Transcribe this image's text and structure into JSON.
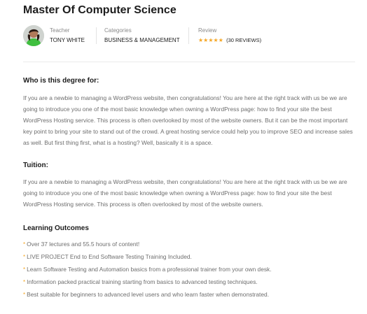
{
  "course": {
    "title": "Master Of Computer Science"
  },
  "meta": {
    "teacher_label": "Teacher",
    "teacher_name": "TONY WHITE",
    "categories_label": "Categories",
    "categories_value": "BUSINESS & MANAGEMENT",
    "review_label": "Review",
    "rating": 5,
    "stars": "★★★★★",
    "review_count_text": "(30 REVIEWS)"
  },
  "sections": {
    "who_title": "Who is this degree for:",
    "who_text": "If you are a newbie to managing a WordPress website, then congratulations! You are here at the right track with us be we are going to introduce you one of the most basic knowledge when owning a WordPress page: how to find your site the best WordPress Hosting service. This process is often overlooked by most of the website owners. But it can be the most important key point to bring your site to stand out of the crowd. A great hosting service could help you to improve SEO and increase sales as well. But first thing first, what is a hosting? Well, basically it is a space.",
    "tuition_title": "Tuition:",
    "tuition_text": "If you are a newbie to managing a WordPress website, then congratulations! You are here at the right track with us be we are going to introduce you one of the most basic knowledge when owning a WordPress page: how to find your site the best WordPress Hosting service. This process is often overlooked by most of the website owners.",
    "outcomes_title": "Learning Outcomes",
    "outcomes_bullet": "*",
    "outcomes": [
      "Over 37 lectures and 55.5 hours of content!",
      "LIVE PROJECT End to End Software Testing Training Included.",
      "Learn Software Testing and Automation basics from a professional trainer from your own desk.",
      "Information packed practical training starting from basics to advanced testing techniques.",
      "Best suitable for beginners to advanced level users and who learn faster when demonstrated."
    ]
  },
  "colors": {
    "accent": "#f5a623",
    "heading": "#1c1c1c",
    "body_text": "#6e6e6e",
    "muted_label": "#8a8a8a"
  }
}
